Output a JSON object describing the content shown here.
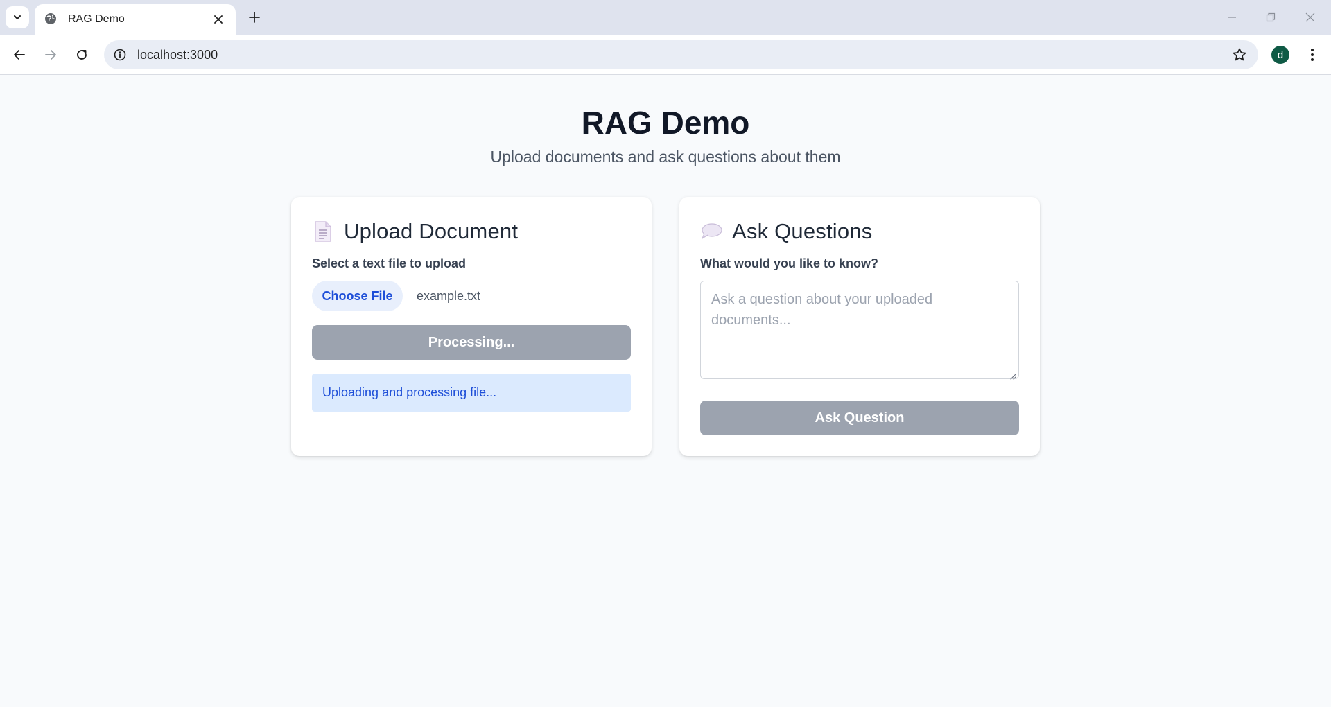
{
  "browser": {
    "tab_title": "RAG Demo",
    "url": "localhost:3000",
    "profile_initial": "d",
    "icons": [
      "tab-search-icon",
      "globe-icon",
      "close-icon",
      "plus-icon",
      "minimize-icon",
      "restore-icon",
      "window-close-icon",
      "back-icon",
      "forward-icon",
      "reload-icon",
      "info-icon",
      "star-icon",
      "kebab-menu-icon"
    ]
  },
  "header": {
    "title": "RAG Demo",
    "subtitle": "Upload documents and ask questions about them"
  },
  "upload": {
    "icon": "document-icon",
    "title": "Upload Document",
    "label": "Select a text file to upload",
    "choose_label": "Choose File",
    "file_name": "example.txt",
    "button_label": "Processing...",
    "status_text": "Uploading and processing file..."
  },
  "ask": {
    "icon": "speech-bubble-icon",
    "title": "Ask Questions",
    "label": "What would you like to know?",
    "placeholder": "Ask a question about your uploaded documents...",
    "button_label": "Ask Question"
  },
  "colors": {
    "accent": "#1d4ed8",
    "disabled_button": "#9ca3af",
    "status_bg": "#dbeafe"
  }
}
